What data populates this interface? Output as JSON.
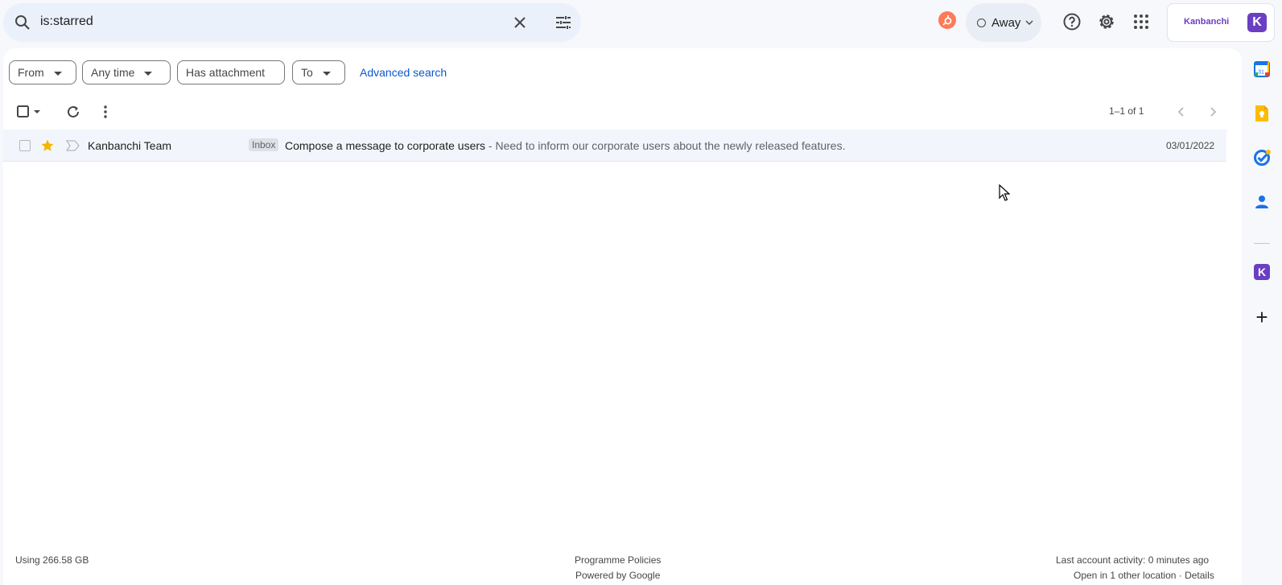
{
  "search": {
    "query": "is:starred"
  },
  "status": {
    "label": "Away"
  },
  "addon": {
    "brand": "Kanbanchi",
    "badge": "K"
  },
  "filters": {
    "from": "From",
    "time": "Any time",
    "attachment": "Has attachment",
    "to": "To",
    "advanced": "Advanced search"
  },
  "pagination": {
    "label": "1–1 of 1"
  },
  "emails": [
    {
      "sender": "Kanbanchi Team",
      "label": "Inbox",
      "subject": "Compose a message to corporate users",
      "snippet": " - Need to inform our corporate users about the newly released features.",
      "date": "03/01/2022",
      "starred": true
    }
  ],
  "footer": {
    "storage": "Using 266.58 GB",
    "policies": "Programme Policies",
    "powered": "Powered by Google",
    "activity": "Last account activity: 0 minutes ago",
    "location": "Open in 1 other location · Details"
  },
  "sidepanel": {
    "calendar_day": "31",
    "add": "+",
    "badge": "K"
  },
  "colors": {
    "accent": "#0b57d0",
    "star": "#f4b400",
    "kanbanchi": "#6a3fc2"
  },
  "icons": [
    "search-icon",
    "close-icon",
    "tune-icon",
    "help-icon",
    "gear-icon",
    "apps-icon",
    "refresh-icon",
    "more-icon",
    "star-icon",
    "important-icon",
    "calendar-icon",
    "keep-icon",
    "tasks-icon",
    "contacts-icon"
  ]
}
